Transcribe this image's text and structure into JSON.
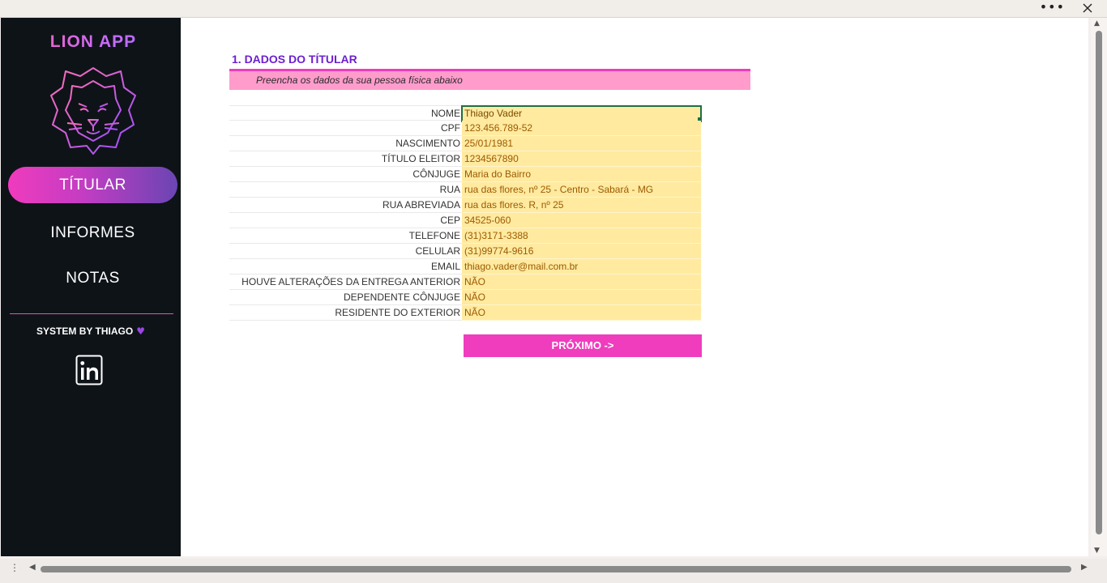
{
  "window": {
    "more_label": "•••"
  },
  "sidebar": {
    "brand": "LION APP",
    "nav": [
      {
        "label": "TÍTULAR",
        "active": true
      },
      {
        "label": "INFORMES",
        "active": false
      },
      {
        "label": "NOTAS",
        "active": false
      }
    ],
    "signature": "SYSTEM BY THIAGO",
    "heart": "♥",
    "social_icon": "linkedin-icon"
  },
  "form": {
    "title": "1. DADOS DO TÍTULAR",
    "subtitle": "Preencha os dados da sua pessoa física abaixo",
    "fields": [
      {
        "label": "NOME",
        "value": "Thiago Vader"
      },
      {
        "label": "CPF",
        "value": "123.456.789-52"
      },
      {
        "label": "NASCIMENTO",
        "value": "25/01/1981"
      },
      {
        "label": "TÍTULO ELEITOR",
        "value": "1234567890"
      },
      {
        "label": "CÔNJUGE",
        "value": "Maria do Bairro"
      },
      {
        "label": "RUA",
        "value": "rua das flores, nº 25 - Centro - Sabará - MG"
      },
      {
        "label": "RUA ABREVIADA",
        "value": "rua das flores. R, nº 25"
      },
      {
        "label": "CEP",
        "value": "34525-060"
      },
      {
        "label": "TELEFONE",
        "value": "(31)3171-3388"
      },
      {
        "label": "CELULAR",
        "value": "(31)99774-9616"
      },
      {
        "label": "EMAIL",
        "value": "thiago.vader@mail.com.br"
      },
      {
        "label": "HOUVE ALTERAÇÕES DA ENTREGA ANTERIOR",
        "value": "NÃO"
      },
      {
        "label": "DEPENDENTE CÔNJUGE",
        "value": "NÃO"
      },
      {
        "label": "RESIDENTE DO EXTERIOR",
        "value": "NÃO"
      }
    ],
    "next_button": "PRÓXIMO ->"
  },
  "colors": {
    "sidebar_bg": "#0e1318",
    "accent_pink": "#ef3dbe",
    "title_purple": "#6d1fd0",
    "subtitle_bg": "#ff9ccc",
    "input_bg": "#ffeaa0"
  }
}
